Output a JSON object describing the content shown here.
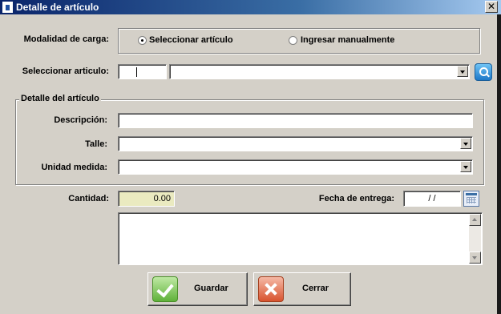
{
  "window": {
    "title": "Detalle de artículo",
    "close_label": "✕"
  },
  "modalidad": {
    "label": "Modalidad de carga:",
    "options": [
      {
        "label": "Seleccionar artículo",
        "selected": true
      },
      {
        "label": "Ingresar manualmente",
        "selected": false
      }
    ]
  },
  "seleccionar": {
    "label": "Seleccionar articulo:",
    "code_value": "",
    "name_value": ""
  },
  "detalle": {
    "group_title": "Detalle del artículo",
    "descripcion": {
      "label": "Descripción:",
      "value": ""
    },
    "talle": {
      "label": "Talle:",
      "value": ""
    },
    "unidad": {
      "label": "Unidad medida:",
      "value": ""
    }
  },
  "cantidad": {
    "label": "Cantidad:",
    "value": "0.00"
  },
  "fecha": {
    "label": "Fecha de entrega:",
    "value": "/ /"
  },
  "notes": {
    "value": ""
  },
  "buttons": {
    "guardar": "Guardar",
    "cerrar": "Cerrar"
  },
  "icons": {
    "search": "search-icon",
    "calendar": "calendar-icon",
    "guardar": "checkmark-icon",
    "cerrar": "close-x-icon"
  },
  "colors": {
    "cantidad_bg": "#eaeac0",
    "title_bar": "#0a246a"
  }
}
